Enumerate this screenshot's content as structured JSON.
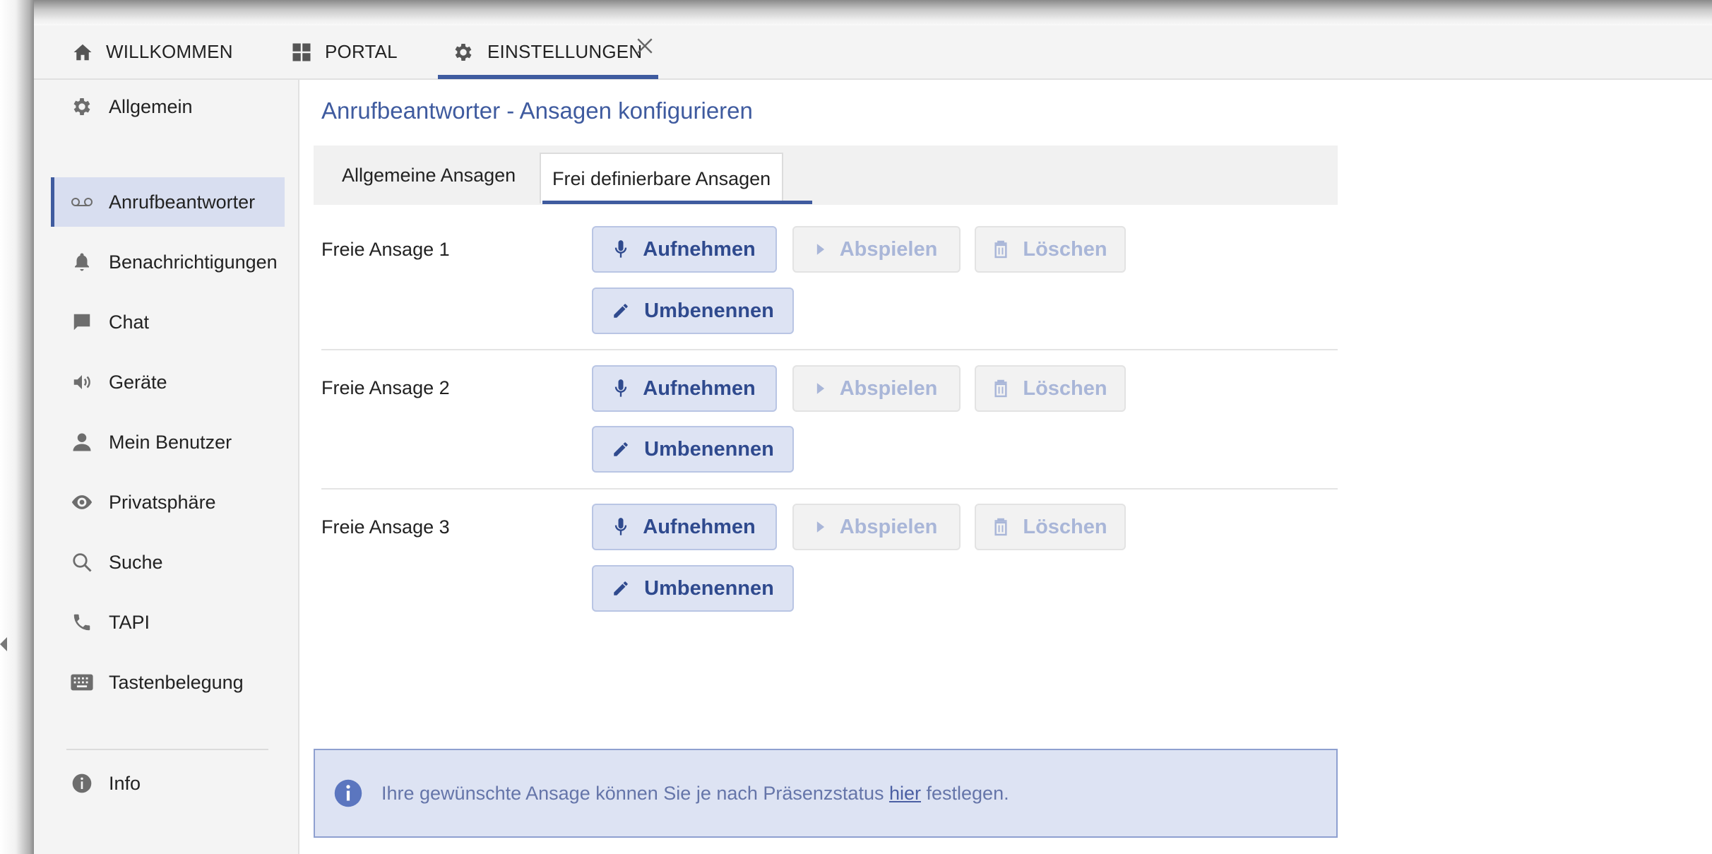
{
  "top_tabs": [
    {
      "label": "WILLKOMMEN",
      "icon": "home-icon"
    },
    {
      "label": "PORTAL",
      "icon": "grid-icon"
    },
    {
      "label": "EINSTELLUNGEN",
      "icon": "gear-icon",
      "active": true,
      "closable": true
    }
  ],
  "sidebar": {
    "items": [
      {
        "label": "Allgemein",
        "icon": "gear-icon"
      },
      {
        "label": "Anrufbeantworter",
        "icon": "voicemail-icon",
        "active": true
      },
      {
        "label": "Benachrichtigungen",
        "icon": "bell-icon"
      },
      {
        "label": "Chat",
        "icon": "chat-icon"
      },
      {
        "label": "Geräte",
        "icon": "speaker-icon"
      },
      {
        "label": "Mein Benutzer",
        "icon": "user-icon"
      },
      {
        "label": "Privatsphäre",
        "icon": "eye-icon"
      },
      {
        "label": "Suche",
        "icon": "search-icon"
      },
      {
        "label": "TAPI",
        "icon": "phone-icon"
      },
      {
        "label": "Tastenbelegung",
        "icon": "keyboard-icon"
      },
      {
        "label": "Info",
        "icon": "info-icon"
      }
    ]
  },
  "main": {
    "title": "Anrufbeantworter - Ansagen konfigurieren",
    "subtabs": [
      {
        "label": "Allgemeine Ansagen"
      },
      {
        "label": "Frei definierbare Ansagen",
        "active": true
      }
    ],
    "rows": [
      {
        "label": "Freie Ansage 1"
      },
      {
        "label": "Freie Ansage 2"
      },
      {
        "label": "Freie Ansage 3"
      }
    ],
    "buttons": {
      "record": "Aufnehmen",
      "play": "Abspielen",
      "delete": "Löschen",
      "rename": "Umbenennen"
    },
    "info": {
      "text_before": "Ihre gewünschte Ansage können Sie je nach Präsenzstatus ",
      "link": "hier",
      "text_after": " festlegen."
    }
  },
  "colors": {
    "accent": "#3f5b9f",
    "active_bg": "#d8def0",
    "primary_button_bg": "#dde3f3",
    "disabled_text": "#a9b6d8"
  }
}
